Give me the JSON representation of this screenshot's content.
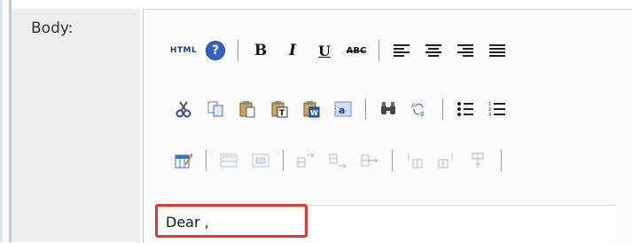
{
  "field": {
    "label": "Body:"
  },
  "editor": {
    "content_text": "Dear ,",
    "icons": {
      "row1": [
        "html-source-icon",
        "help-icon",
        "bold-icon",
        "italic-icon",
        "underline-icon",
        "strikethrough-icon",
        "align-left-icon",
        "align-center-icon",
        "align-right-icon",
        "align-justify-icon"
      ],
      "row2": [
        "cut-icon",
        "copy-icon",
        "paste-icon",
        "paste-text-icon",
        "paste-word-icon",
        "clean-format-icon",
        "find-icon",
        "replace-icon",
        "bullet-list-icon",
        "numbered-list-icon"
      ],
      "row3": [
        "edit-table-icon",
        "table-props-icon",
        "cell-props-icon",
        "insert-row-before-icon",
        "insert-row-after-icon",
        "delete-row-icon",
        "insert-col-before-icon",
        "insert-col-after-icon",
        "delete-col-icon"
      ]
    },
    "toolbar_labels": {
      "html": "HTML",
      "help": "?",
      "bold": "B",
      "italic": "I",
      "underline": "U",
      "strike": "ABC"
    }
  },
  "colors": {
    "highlight": "#e1392b",
    "label_bg": "#eeeeee",
    "editor_bg": "#fbfbfb"
  }
}
